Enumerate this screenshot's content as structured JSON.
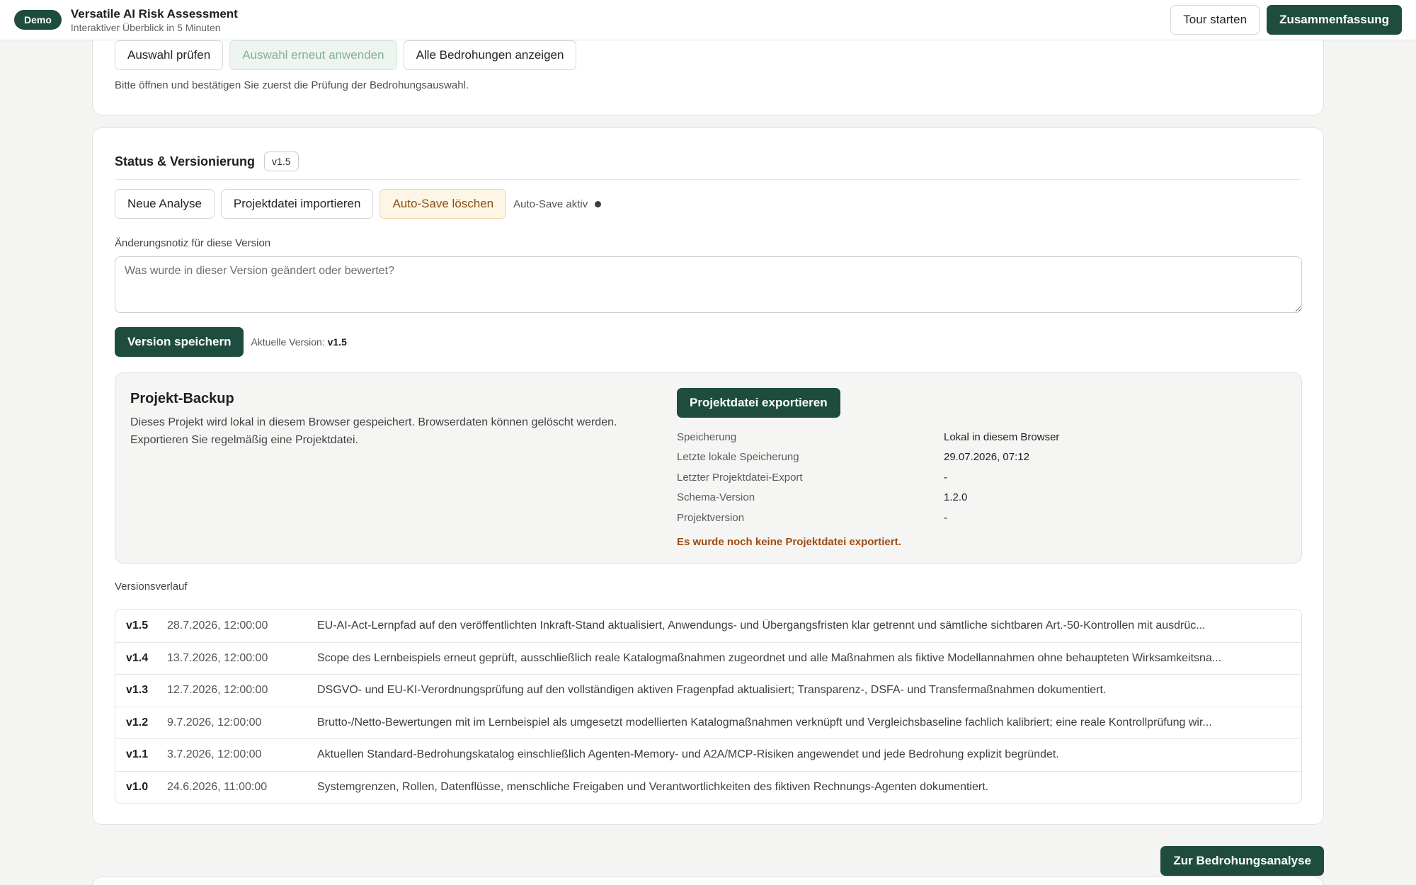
{
  "header": {
    "badge": "Demo",
    "title": "Versatile AI Risk Assessment",
    "subtitle": "Interaktiver Überblick in 5 Minuten",
    "tour_label": "Tour starten",
    "summary_label": "Zusammenfassung"
  },
  "selection": {
    "check_label": "Auswahl prüfen",
    "reapply_label": "Auswahl erneut anwenden",
    "show_all_label": "Alle Bedrohungen anzeigen",
    "hint": "Bitte öffnen und bestätigen Sie zuerst die Prüfung der Bedrohungsauswahl."
  },
  "status": {
    "title": "Status & Versionierung",
    "version_chip": "v1.5",
    "new_analysis_label": "Neue Analyse",
    "import_label": "Projektdatei importieren",
    "clear_autosave_label": "Auto-Save löschen",
    "autosave_status": "Auto-Save aktiv",
    "note_label": "Änderungsnotiz für diese Version",
    "note_value": "",
    "note_placeholder": "Was wurde in dieser Version geändert oder bewertet?",
    "save_label": "Version speichern",
    "current_version_label": "Aktuelle Version:",
    "current_version": "v1.5"
  },
  "backup": {
    "title": "Projekt-Backup",
    "description": "Dieses Projekt wird lokal in diesem Browser gespeichert. Browserdaten können gelöscht werden. Exportieren Sie regelmäßig eine Projektdatei.",
    "export_label": "Projektdatei exportieren",
    "meta": [
      {
        "key": "Speicherung",
        "value": "Lokal in diesem Browser"
      },
      {
        "key": "Letzte lokale Speicherung",
        "value": "29.07.2026, 07:12"
      },
      {
        "key": "Letzter Projektdatei-Export",
        "value": "-"
      },
      {
        "key": "Schema-Version",
        "value": "1.2.0"
      },
      {
        "key": "Projektversion",
        "value": "-"
      }
    ],
    "warning": "Es wurde noch keine Projektdatei exportiert."
  },
  "history": {
    "label": "Versionsverlauf",
    "rows": [
      {
        "version": "v1.5",
        "date": "28.7.2026, 12:00:00",
        "text": "EU-AI-Act-Lernpfad auf den veröffentlichten Inkraft-Stand aktualisiert, Anwendungs- und Übergangsfristen klar getrennt und sämtliche sichtbaren Art.-50-Kontrollen mit ausdrüc..."
      },
      {
        "version": "v1.4",
        "date": "13.7.2026, 12:00:00",
        "text": "Scope des Lernbeispiels erneut geprüft, ausschließlich reale Katalogmaßnahmen zugeordnet und alle Maßnahmen als fiktive Modellannahmen ohne behaupteten Wirksamkeitsna..."
      },
      {
        "version": "v1.3",
        "date": "12.7.2026, 12:00:00",
        "text": "DSGVO- und EU-KI-Verordnungsprüfung auf den vollständigen aktiven Fragenpfad aktualisiert; Transparenz-, DSFA- und Transfermaßnahmen dokumentiert."
      },
      {
        "version": "v1.2",
        "date": "9.7.2026, 12:00:00",
        "text": "Brutto-/Netto-Bewertungen mit im Lernbeispiel als umgesetzt modellierten Katalogmaßnahmen verknüpft und Vergleichsbaseline fachlich kalibriert; eine reale Kontrollprüfung wir..."
      },
      {
        "version": "v1.1",
        "date": "3.7.2026, 12:00:00",
        "text": "Aktuellen Standard-Bedrohungskatalog einschließlich Agenten-Memory- und A2A/MCP-Risiken angewendet und jede Bedrohung explizit begründet."
      },
      {
        "version": "v1.0",
        "date": "24.6.2026, 11:00:00",
        "text": "Systemgrenzen, Rollen, Datenflüsse, menschliche Freigaben und Verantwortlichkeiten des fiktiven Rechnungs-Agenten dokumentiert."
      }
    ]
  },
  "footer": {
    "next_label": "Zur Bedrohungsanalyse"
  }
}
